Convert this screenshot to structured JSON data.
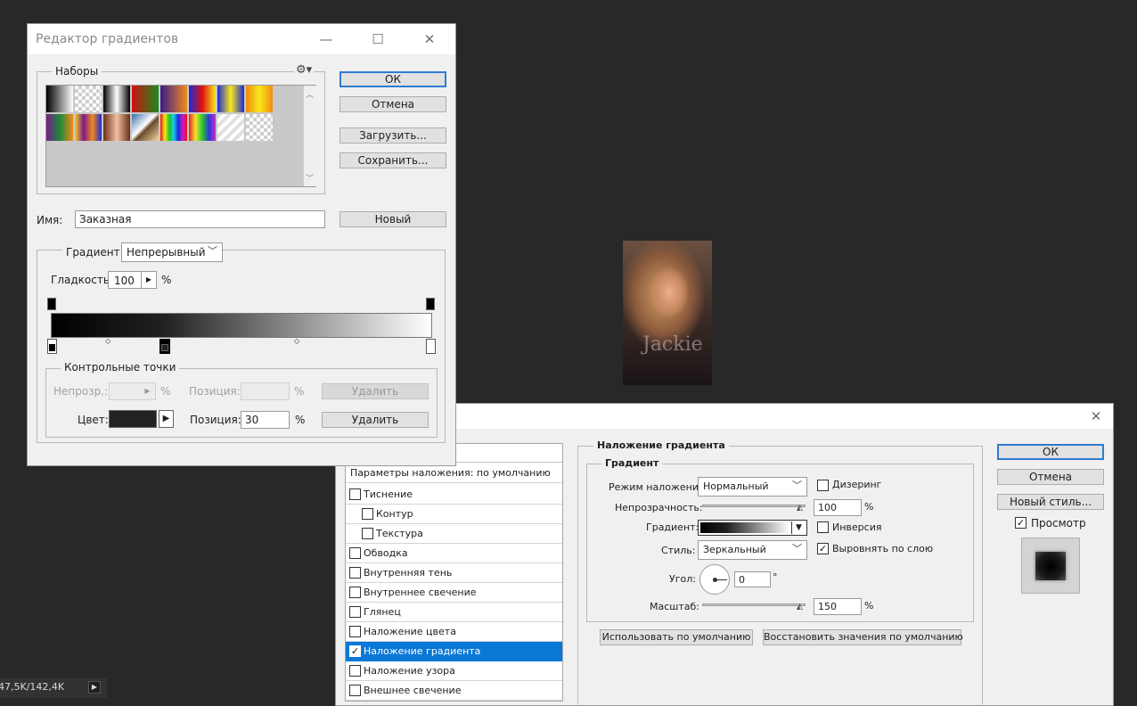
{
  "background": {
    "color": "#282828"
  },
  "gradient_editor": {
    "title": "Редактор градиентов",
    "presets_label": "Наборы",
    "presets": [
      "черный-белый",
      "прозрачный",
      "черный-белый-черный",
      "красный-зеленый",
      "фиолетовый-оранжевый",
      "синий-красный-желтый",
      "синий-желтый-синий",
      "оранжевый-желтый-оранжевый",
      "фиолетовый-зеленый-оранжевый",
      "желтый-фиолетовый-оранжевый-синий",
      "медь",
      "хром",
      "цвета спектра",
      "прозрачная радуга",
      "прозрачные полосы",
      "прозрачная шахматка"
    ],
    "buttons": {
      "ok": "ОК",
      "cancel": "Отмена",
      "load": "Загрузить...",
      "save": "Сохранить...",
      "new": "Новый"
    },
    "name_label": "Имя:",
    "name_value": "Заказная",
    "gradient_type_label": "Градиент:",
    "gradient_type_value": "Непрерывный",
    "smoothness_label": "Гладкость:",
    "smoothness_value": "100",
    "smoothness_unit": "%",
    "stops_group_label": "Контрольные точки",
    "opacity_label": "Непрозр.:",
    "opacity_unit": "%",
    "location_label": "Позиция:",
    "location_unit": "%",
    "delete_label": "Удалить",
    "color_label": "Цвет:",
    "color_location_value": "30",
    "stop_color": "#222222",
    "gradient_stops": [
      {
        "color": "#000000",
        "location": 0
      },
      {
        "color": "#222222",
        "location": 30
      },
      {
        "color": "#ffffff",
        "location": 100
      }
    ]
  },
  "canvas": {
    "watermark": "Jackie"
  },
  "status_bar": {
    "doc_size": "47,5K/142,4K"
  },
  "layer_style": {
    "list_header": "Параметры наложения: по умолчанию",
    "effects": [
      {
        "label": "Тиснение",
        "checked": false
      },
      {
        "label": "Контур",
        "checked": false
      },
      {
        "label": "Текстура",
        "checked": false
      },
      {
        "label": "Обводка",
        "checked": false
      },
      {
        "label": "Внутренняя тень",
        "checked": false
      },
      {
        "label": "Внутреннее свечение",
        "checked": false
      },
      {
        "label": "Глянец",
        "checked": false
      },
      {
        "label": "Наложение цвета",
        "checked": false
      },
      {
        "label": "Наложение градиента",
        "checked": true
      },
      {
        "label": "Наложение узора",
        "checked": false
      },
      {
        "label": "Внешнее свечение",
        "checked": false
      }
    ],
    "section_title": "Наложение градиента",
    "subsection_title": "Градиент",
    "blend_mode_label": "Режим наложения:",
    "blend_mode_value": "Нормальный",
    "dither_label": "Дизеринг",
    "opacity_label": "Непрозрачность:",
    "opacity_value": "100",
    "opacity_unit": "%",
    "gradient_label": "Градиент:",
    "reverse_label": "Инверсия",
    "style_label": "Стиль:",
    "style_value": "Зеркальный",
    "align_label": "Выровнять по слою",
    "angle_label": "Угол:",
    "angle_value": "0",
    "angle_unit": "°",
    "scale_label": "Масштаб:",
    "scale_value": "150",
    "scale_unit": "%",
    "make_default": "Использовать по умолчанию",
    "reset_default": "Восстановить значения по умолчанию",
    "buttons": {
      "ok": "ОК",
      "cancel": "Отмена",
      "new_style": "Новый стиль..."
    },
    "preview_label": "Просмотр",
    "preview_checked": true
  }
}
